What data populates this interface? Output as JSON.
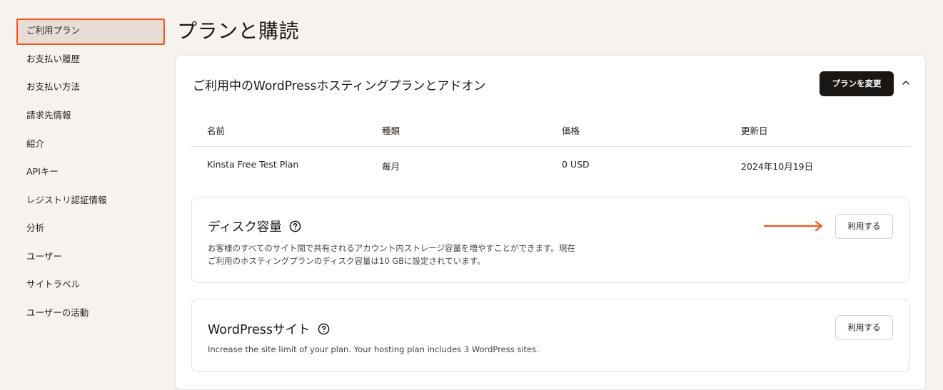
{
  "sidebar": {
    "items": [
      {
        "label": "ご利用プラン",
        "active": true
      },
      {
        "label": "お支払い履歴"
      },
      {
        "label": "お支払い方法"
      },
      {
        "label": "請求先情報"
      },
      {
        "label": "紹介"
      },
      {
        "label": "APIキー"
      },
      {
        "label": "レジストリ認証情報"
      },
      {
        "label": "分析"
      },
      {
        "label": "ユーザー"
      },
      {
        "label": "サイトラベル"
      },
      {
        "label": "ユーザーの活動"
      }
    ]
  },
  "page": {
    "title": "プランと購読"
  },
  "plan_card": {
    "title": "ご利用中のWordPressホスティングプランとアドオン",
    "change_plan_label": "プランを変更",
    "collapse_icon": "chevron-up-icon",
    "table": {
      "headers": [
        "名前",
        "種類",
        "価格",
        "更新日"
      ],
      "rows": [
        [
          "Kinsta Free Test Plan",
          "毎月",
          "0 USD",
          "2024年10月19日"
        ]
      ]
    }
  },
  "addons": [
    {
      "title": "ディスク容量",
      "help_icon": "question-circle-icon",
      "description_lines": [
        "お客様のすべてのサイト間で共有されるアカウント内ストレージ容量を増やすことができます。現在",
        "ご利用のホスティングプランのディスク容量は10 GBに設定されています。"
      ],
      "button_label": "利用する"
    },
    {
      "title": "WordPressサイト",
      "help_icon": "question-circle-icon",
      "description_lines": [
        "Increase the site limit of your plan. Your hosting plan includes 3 WordPress sites."
      ],
      "button_label": "利用する"
    }
  ],
  "colors": {
    "accent": "#f2581c",
    "background": "#f6f2ef",
    "active_nav": "#e8ddd6",
    "dark_button": "#1a1614"
  }
}
